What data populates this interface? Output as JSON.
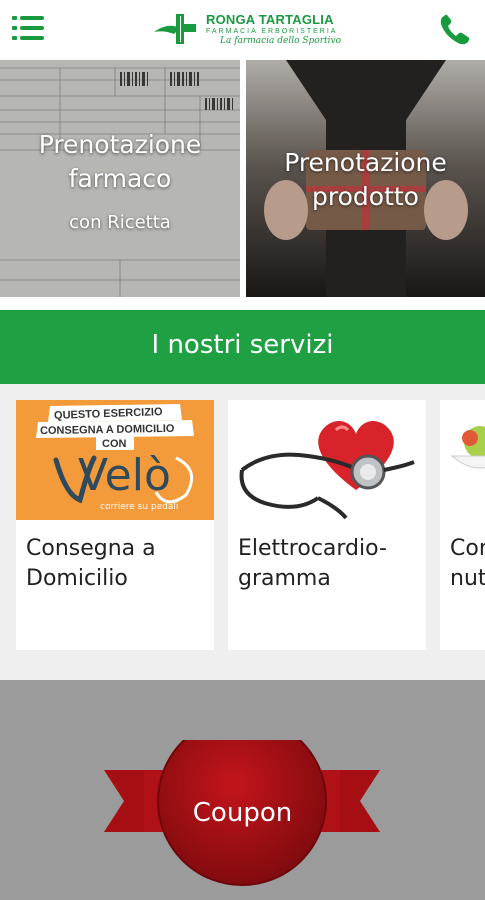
{
  "header": {
    "menu_icon": "hamburger-menu-icon",
    "logo": {
      "title": "RONGA TARTAGLIA",
      "subtitle": "FARMACIA ERBORISTERIA",
      "tagline": "La farmacia dello Sportivo"
    },
    "phone_icon": "phone-icon"
  },
  "hero": {
    "left": {
      "title": "Prenotazione farmaco",
      "subtitle": "con Ricetta"
    },
    "right": {
      "title": "Prenotazione prodotto"
    }
  },
  "services": {
    "heading": "I nostri servizi",
    "cards": [
      {
        "label": "Consegna a\nDomicilio",
        "image_text": [
          "QUESTO ESERCIZIO",
          "CONSEGNA A DOMICILIO",
          "CON",
          "Velò",
          "corriere su pedali"
        ]
      },
      {
        "label": "Elettrocardio-\ngramma"
      },
      {
        "label": "Con\nnut"
      }
    ]
  },
  "coupon": {
    "label": "Coupon"
  },
  "colors": {
    "brand_green": "#1a9a3f",
    "banner_green": "#1fa043",
    "coupon_red": "#9e0e12",
    "velo_orange": "#f39a3a"
  }
}
